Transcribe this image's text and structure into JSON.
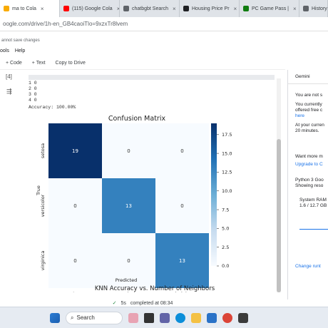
{
  "browser": {
    "tabs": [
      {
        "label": "ma to Cola",
        "color": "#f9ab00",
        "active": true
      },
      {
        "label": "(115) Google Cola",
        "color": "#ff0000",
        "active": false
      },
      {
        "label": "chatbgbt Search",
        "color": "#5f6368",
        "active": false
      },
      {
        "label": "Housing Price Pr",
        "color": "#202124",
        "active": false
      },
      {
        "label": "PC Game Pass |",
        "color": "#107c10",
        "active": false
      },
      {
        "label": "History",
        "color": "#5f6368",
        "active": false
      }
    ],
    "url": "oogle.com/drive/1h-en_GB4caoiTlo=9xzxTr8lvem"
  },
  "notebook": {
    "save_status": "annot save changes",
    "menus": [
      "ools",
      "Help"
    ],
    "toolbar": {
      "code": "+ Code",
      "text": "+ Text",
      "copy": "Copy to Drive"
    },
    "cell_label": "[4]",
    "output_lines": [
      "1        0",
      "2        0",
      "3        0",
      "4        0",
      "Accuracy: 100.00%"
    ]
  },
  "chart_data": [
    {
      "type": "heatmap",
      "title": "Confusion Matrix",
      "xlabel": "Predicted",
      "ylabel": "True",
      "x_categories": [
        "setosa",
        "versicolor",
        "virginica"
      ],
      "y_categories": [
        "setosa",
        "versicolor",
        "virginica"
      ],
      "values": [
        [
          19,
          0,
          0
        ],
        [
          0,
          13,
          0
        ],
        [
          0,
          0,
          13
        ]
      ],
      "colorbar": {
        "min": 0,
        "max": 19,
        "ticks": [
          0.0,
          2.5,
          5.0,
          7.5,
          10.0,
          12.5,
          15.0,
          17.5
        ]
      },
      "colormap": {
        "low": "#f7fbff",
        "high": "#08306b"
      }
    },
    {
      "type": "line",
      "title": "KNN Accuracy vs. Number of Neighbors"
    }
  ],
  "sidebar": {
    "title": "Gemini",
    "lines": [
      "You are not s",
      "You currently",
      "offered free c",
      "here",
      "At your curren",
      "20 minutes."
    ],
    "want_more": "Want more m",
    "upgrade": "Upgrade to C",
    "python": "Python 3 Goo",
    "showing": "Showing reso",
    "ram_label": "System RAM",
    "ram_value": "1.6 / 12.7 GB",
    "change_runtime": "Change runt"
  },
  "status": {
    "seconds": "5s",
    "completed": "completed at 08:34"
  },
  "taskbar": {
    "search_label": "Search"
  }
}
